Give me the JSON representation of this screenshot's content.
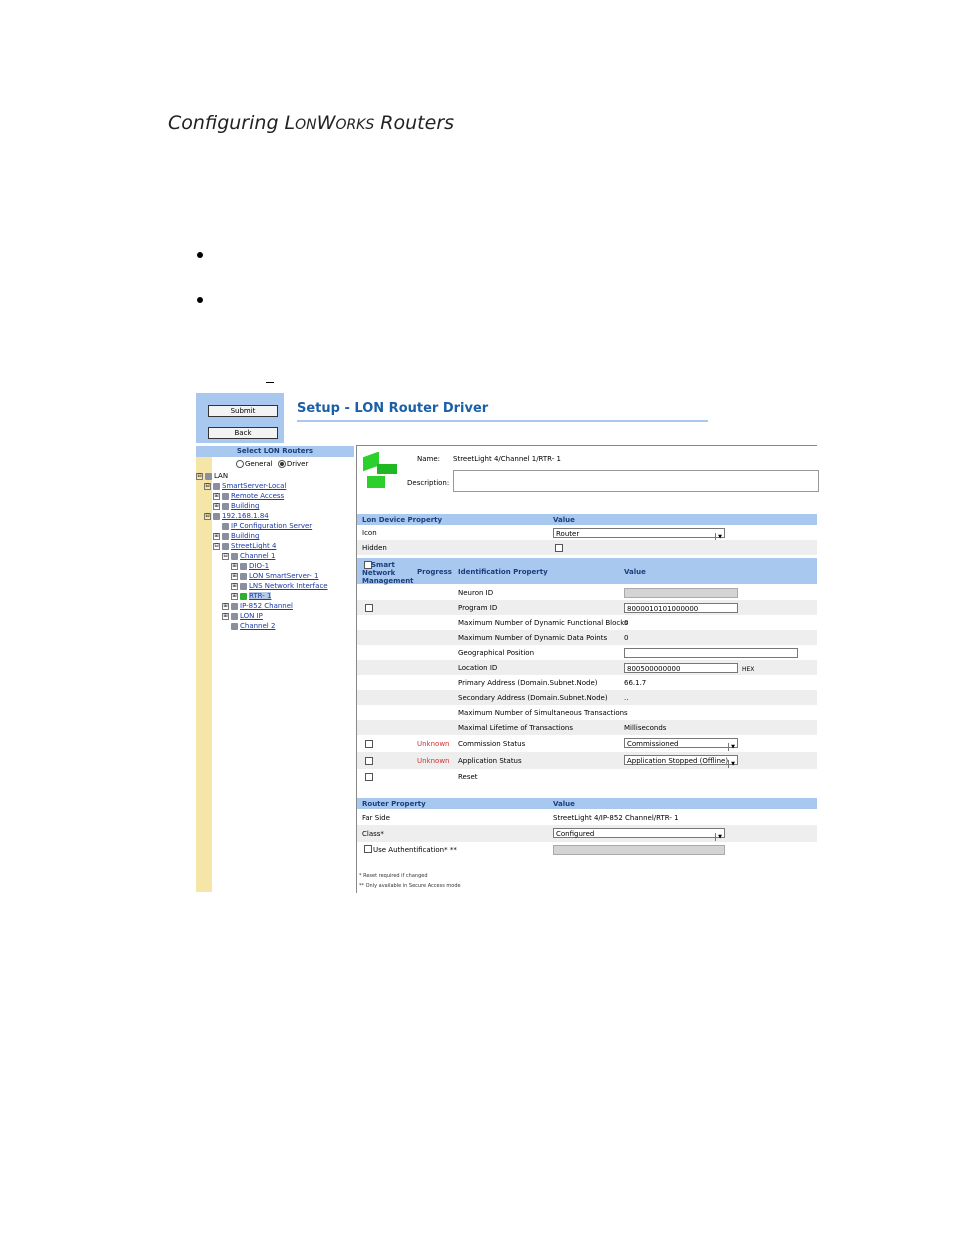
{
  "doc": {
    "title_prefix": "Configuring L",
    "title_sc1": "ON",
    "title_mid": "W",
    "title_sc2": "ORKS",
    "title_suffix": " Routers"
  },
  "app": {
    "submit_label": "Submit",
    "back_label": "Back",
    "page_title": "Setup - LON Router Driver"
  },
  "tree": {
    "header": "Select LON Routers",
    "radio_general": "General",
    "radio_driver": "Driver",
    "items": [
      {
        "label": "LAN",
        "expander": "⊟",
        "link": false
      },
      {
        "label": "SmartServer-Local",
        "expander": "⊟",
        "link": true
      },
      {
        "label": "Remote Access",
        "expander": "⊞",
        "link": true
      },
      {
        "label": "Building",
        "expander": "⊞",
        "link": true
      },
      {
        "label": "192.168.1.84",
        "expander": "⊟",
        "link": true
      },
      {
        "label": "IP Configuration Server",
        "expander": "",
        "link": true
      },
      {
        "label": "Building",
        "expander": "⊞",
        "link": true
      },
      {
        "label": "StreetLight 4",
        "expander": "⊟",
        "link": true
      },
      {
        "label": "Channel 1",
        "expander": "⊟",
        "link": true
      },
      {
        "label": "DIO-1",
        "expander": "⊞",
        "link": true
      },
      {
        "label": "LON SmartServer- 1",
        "expander": "⊞",
        "link": true
      },
      {
        "label": "LNS Network Interface",
        "expander": "⊞",
        "link": true
      },
      {
        "label": "RTR- 1",
        "expander": "⊞",
        "link": true
      },
      {
        "label": "IP-852 Channel",
        "expander": "⊞",
        "link": true
      },
      {
        "label": "LON IP",
        "expander": "⊞",
        "link": true
      },
      {
        "label": "Channel 2",
        "expander": "",
        "link": true
      }
    ]
  },
  "device": {
    "name_label": "Name:",
    "name_value": "StreetLight 4/Channel 1/RTR- 1",
    "description_label": "Description:",
    "description_value": ""
  },
  "lon_device": {
    "header_property": "Lon Device Property",
    "header_value": "Value",
    "icon_label": "Icon",
    "icon_value": "Router",
    "hidden_label": "Hidden"
  },
  "identification": {
    "header_snm": "Smart Network Management",
    "header_progress": "Progress",
    "header_property": "Identification Property",
    "header_value": "Value",
    "rows": [
      {
        "property": "Neuron ID",
        "value": "",
        "progress": ""
      },
      {
        "property": "Program ID",
        "value": "8000010101000000",
        "progress": ""
      },
      {
        "property": "Maximum Number of Dynamic Functional Blocks",
        "value": "0",
        "progress": ""
      },
      {
        "property": "Maximum Number of Dynamic Data Points",
        "value": "0",
        "progress": ""
      },
      {
        "property": "Geographical Position",
        "value": "",
        "progress": ""
      },
      {
        "property": "Location ID",
        "value": "800500000000",
        "progress": "",
        "suffix": "HEX"
      },
      {
        "property": "Primary Address (Domain.Subnet.Node)",
        "value": "66.1.7",
        "progress": ""
      },
      {
        "property": "Secondary Address (Domain.Subnet.Node)",
        "value": "..",
        "progress": ""
      },
      {
        "property": "Maximum Number of Simultaneous Transactions",
        "value": "",
        "progress": ""
      },
      {
        "property": "Maximal Lifetime of Transactions",
        "value": "Milliseconds",
        "progress": ""
      },
      {
        "property": "Commission Status",
        "value": "Commissioned",
        "progress": "Unknown"
      },
      {
        "property": "Application Status",
        "value": "Application Stopped (Offline)",
        "progress": "Unknown"
      },
      {
        "property": "Reset",
        "value": "",
        "progress": ""
      }
    ]
  },
  "router": {
    "header_property": "Router Property",
    "header_value": "Value",
    "far_side_label": "Far Side",
    "far_side_value": "StreetLight 4/IP-852 Channel/RTR- 1",
    "class_label": "Class*",
    "class_value": "Configured",
    "auth_label": "Use Authentification* **"
  },
  "footnotes": {
    "reset": "* Reset required if changed",
    "secure": "** Only available in Secure Access mode"
  }
}
